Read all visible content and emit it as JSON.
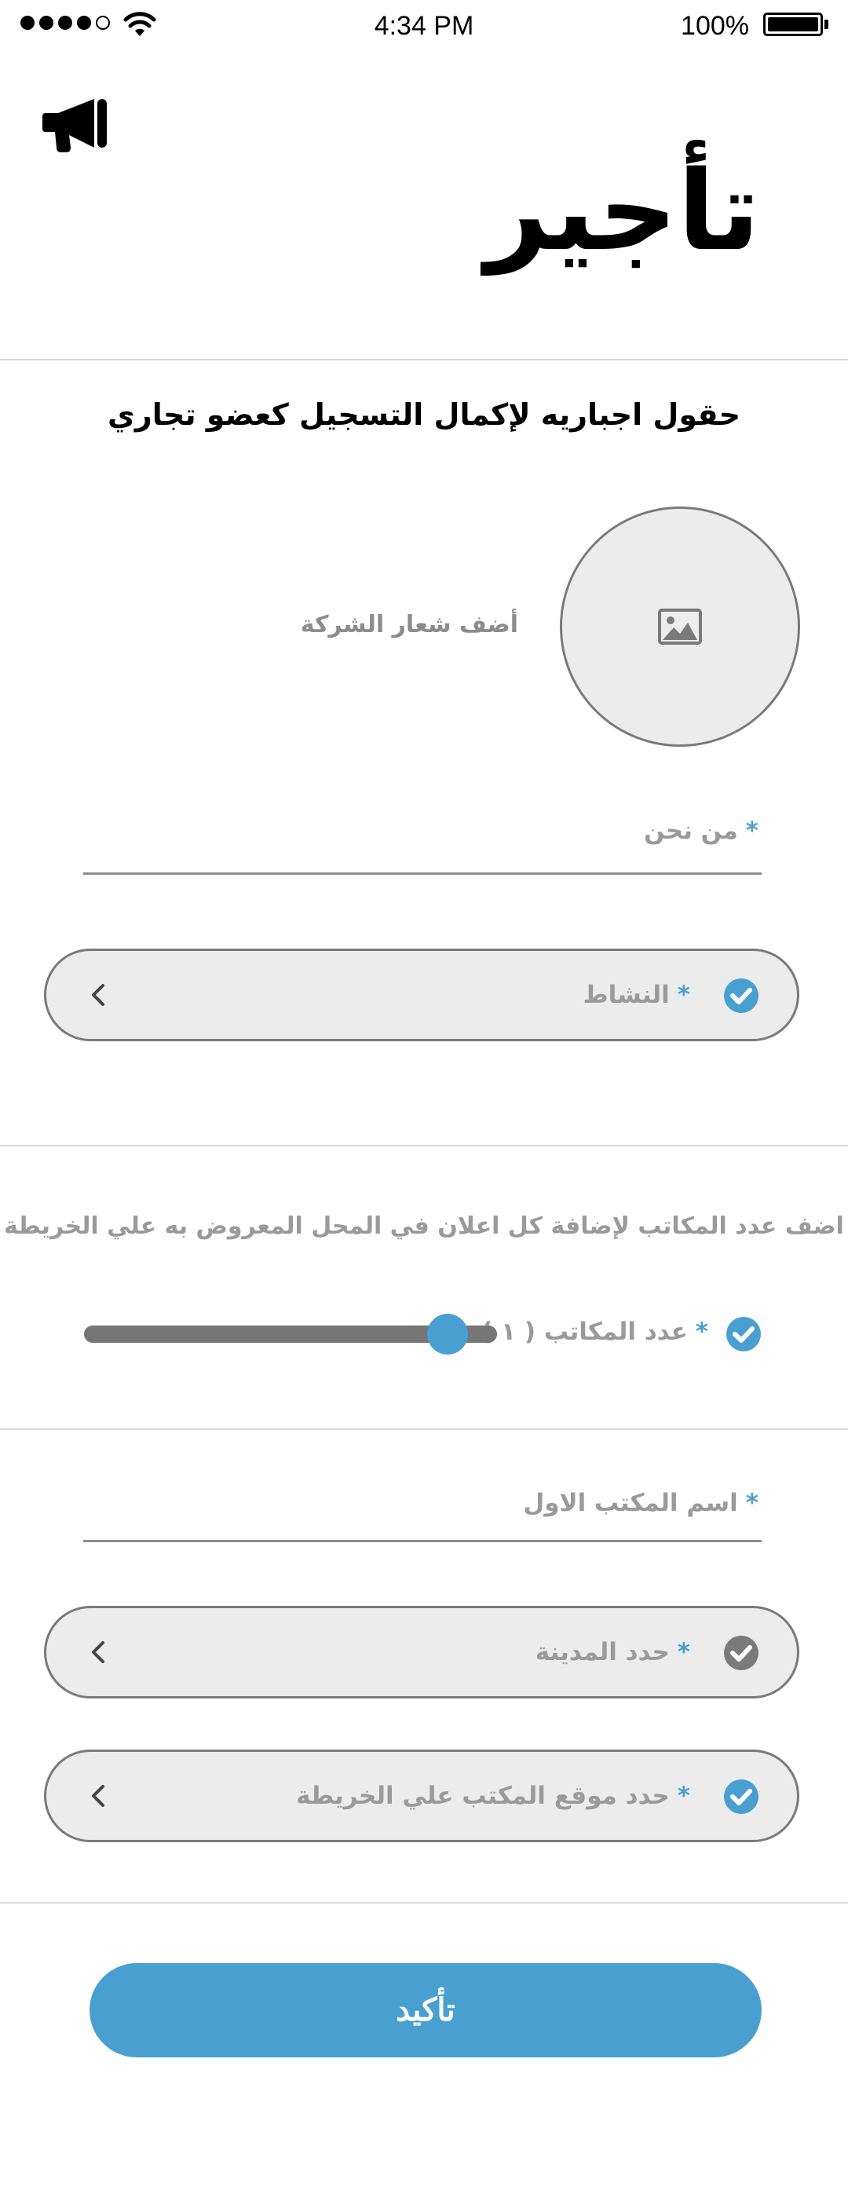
{
  "status_bar": {
    "time": "4:34 PM",
    "battery": "100%",
    "signal_bars": 4
  },
  "header": {
    "icon": "megaphone-icon",
    "title": "تأجير"
  },
  "form": {
    "subtitle": "حقول اجباريه لإكمال التسجيل كعضو تجاري",
    "logo_label": "أضف شعار الشركة",
    "logo_icon": "image-icon",
    "about_label": "من نحن",
    "activity_label": "النشاط",
    "offices_hint": "اضف عدد المكاتب لإضافة كل اعلان في المحل المعروض به علي الخريطة",
    "offices_count_label": "عدد المكاتب ( ١ )",
    "offices_count_value": 1,
    "slider_fraction": 0.88,
    "first_office_label": "اسم المكتب الاول",
    "city_label": "حدد المدينة",
    "map_location_label": "حدد موقع المكتب علي الخريطة",
    "required_mark": "*",
    "confirm_label": "تأكيد"
  },
  "colors": {
    "accent": "#4a9fd1",
    "check_inactive": "#7a7a7a",
    "field_bg": "#ececec",
    "label_gray": "#9a9a9a"
  }
}
